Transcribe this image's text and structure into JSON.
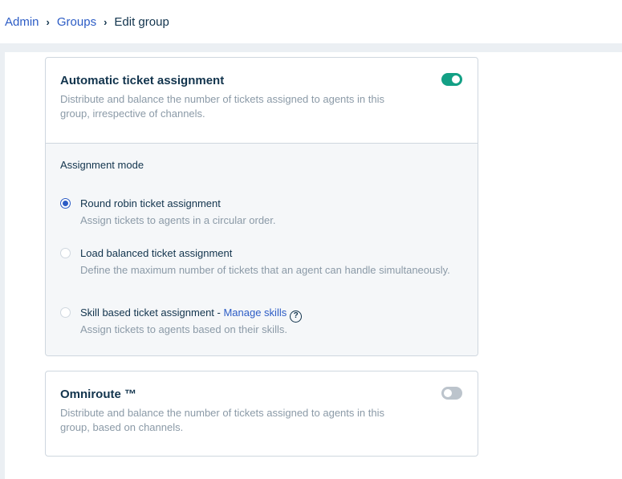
{
  "breadcrumb": {
    "items": [
      "Admin",
      "Groups"
    ],
    "separator": "›",
    "current": "Edit group"
  },
  "auto_assign": {
    "title": "Automatic ticket assignment",
    "description": "Distribute and balance the number of tickets assigned to agents in this group, irrespective of channels.",
    "enabled": true
  },
  "assignment_mode": {
    "label": "Assignment mode",
    "options": [
      {
        "title": "Round robin ticket assignment",
        "description": "Assign tickets to agents in a circular order.",
        "selected": true
      },
      {
        "title": "Load balanced ticket assignment",
        "description": "Define the maximum number of tickets that an agent can handle simultaneously.",
        "selected": false
      },
      {
        "title": "Skill based ticket assignment - ",
        "link": "Manage skills",
        "description": "Assign tickets to agents based on their skills.",
        "selected": false
      }
    ],
    "help_glyph": "?"
  },
  "omniroute": {
    "title": "Omniroute ™",
    "description": "Distribute and balance the number of tickets assigned to agents in this group, based on channels.",
    "enabled": false
  },
  "colors": {
    "link": "#2c5cc5",
    "toggle_on": "#13a085",
    "toggle_off": "#bcc4cc",
    "muted_text": "#8b9aa7"
  }
}
